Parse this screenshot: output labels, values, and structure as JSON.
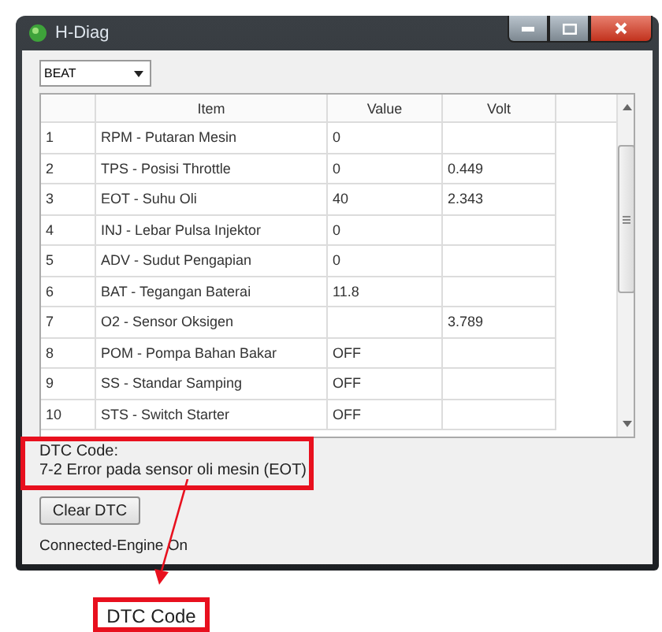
{
  "window": {
    "title": "H-Diag"
  },
  "model_select": {
    "value": "BEAT"
  },
  "table": {
    "columns": [
      "Item",
      "Value",
      "Volt"
    ],
    "rows": [
      {
        "no": "1",
        "item": "RPM - Putaran Mesin",
        "value": "0",
        "volt": ""
      },
      {
        "no": "2",
        "item": "TPS - Posisi Throttle",
        "value": "0",
        "volt": "0.449"
      },
      {
        "no": "3",
        "item": "EOT - Suhu Oli",
        "value": "40",
        "volt": "2.343"
      },
      {
        "no": "4",
        "item": "INJ - Lebar Pulsa Injektor",
        "value": "0",
        "volt": ""
      },
      {
        "no": "5",
        "item": "ADV - Sudut Pengapian",
        "value": "0",
        "volt": ""
      },
      {
        "no": "6",
        "item": "BAT - Tegangan Baterai",
        "value": "11.8",
        "volt": ""
      },
      {
        "no": "7",
        "item": "O2 - Sensor Oksigen",
        "value": "",
        "volt": "3.789"
      },
      {
        "no": "8",
        "item": "POM - Pompa Bahan Bakar",
        "value": "OFF",
        "volt": ""
      },
      {
        "no": "9",
        "item": "SS - Standar Samping",
        "value": "OFF",
        "volt": ""
      },
      {
        "no": "10",
        "item": "STS - Switch Starter",
        "value": "OFF",
        "volt": ""
      }
    ]
  },
  "dtc": {
    "label": "DTC Code:",
    "text": "7-2  Error pada sensor oli mesin (EOT)"
  },
  "clear_button": "Clear DTC",
  "status": "Connected-Engine On",
  "annotation": {
    "label": "DTC Code"
  }
}
